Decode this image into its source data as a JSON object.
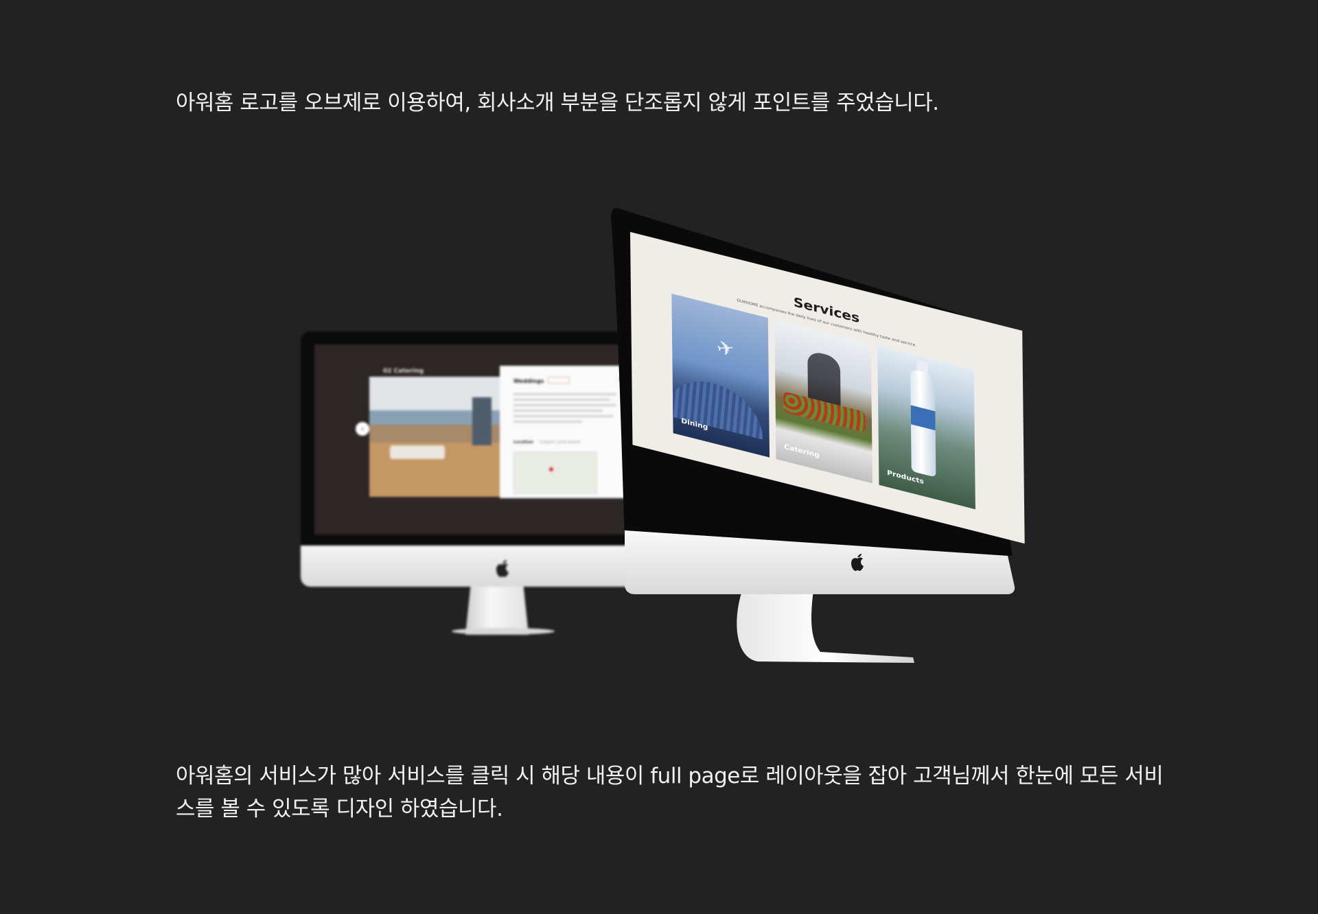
{
  "captions": {
    "top": "아워홈 로고를 오브제로 이용하여, 회사소개 부분을 단조롭지 않게 포인트를 주었습니다.",
    "bottom": "아워홈의 서비스가 많아 서비스를 클릭 시 해당 내용이 full page로 레이아웃을 잡아 고객님께서 한눈에 모든 서비스를 볼 수 있도록 디자인 하였습니다."
  },
  "back_monitor": {
    "section_label": "02 Catering",
    "panel_heading": "Weddings",
    "map_tab_1": "Location",
    "map_tab_2": "Subject Land Scene"
  },
  "front_monitor": {
    "title": "Services",
    "subtitle": "OURHOME accompanies the daily lives of our customers with healthy taste and service.",
    "tiles": [
      {
        "label": "Dining"
      },
      {
        "label": "Catering"
      },
      {
        "label": "Products"
      }
    ]
  },
  "colors": {
    "background": "#222222",
    "text": "#f2f2f2",
    "screen_front": "#f0ece8",
    "screen_back": "#2c2625",
    "monitor_body": "#eeeeee"
  },
  "icons": {
    "apple_logo": "apple-logo-icon",
    "arrow_left": "arrow-left-icon",
    "close": "close-icon"
  }
}
